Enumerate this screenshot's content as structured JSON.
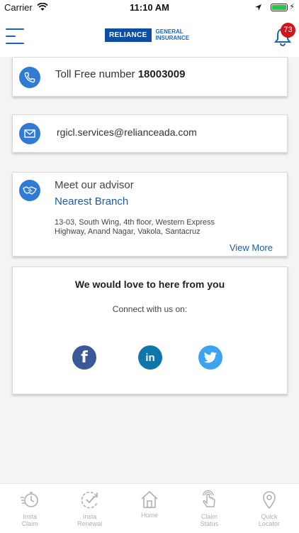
{
  "status_bar": {
    "carrier": "Carrier",
    "time": "11:10 AM"
  },
  "header": {
    "logo": {
      "main": "RELIANCE",
      "sub_line1": "GENERAL",
      "sub_line2": "INSURANCE"
    },
    "notification_count": "73"
  },
  "contact": {
    "toll_free_label": "Toll Free number",
    "toll_free_number": "18003009",
    "email": "rgicl.services@relianceada.com",
    "advisor_title": "Meet our advisor",
    "branch_link": "Nearest Branch",
    "address_line1": "13-03, South Wing, 4th floor, Western Express",
    "address_line2": "Highway, Anand Nagar, Vakola, Santacruz",
    "view_more": "View More"
  },
  "social": {
    "heading": "We would love to here from you",
    "connect_text": "Connect with us on:",
    "facebook_glyph": "f",
    "linkedin_glyph": "in"
  },
  "tabs": [
    {
      "line1": "Insta",
      "line2": "Claim",
      "icon": "stopwatch-icon"
    },
    {
      "line1": "Insta",
      "line2": "Renewal",
      "icon": "renew-check-icon"
    },
    {
      "line1": "Home",
      "line2": "",
      "icon": "home-icon"
    },
    {
      "line1": "Claim",
      "line2": "Status",
      "icon": "tap-hand-icon"
    },
    {
      "line1": "Quick",
      "line2": "Locator",
      "icon": "location-pin-icon"
    }
  ],
  "colors": {
    "brand_blue": "#0f4da2",
    "link_blue": "#1a5ea6",
    "badge_red": "#d0141c",
    "icon_blue": "#2f7bd6"
  }
}
